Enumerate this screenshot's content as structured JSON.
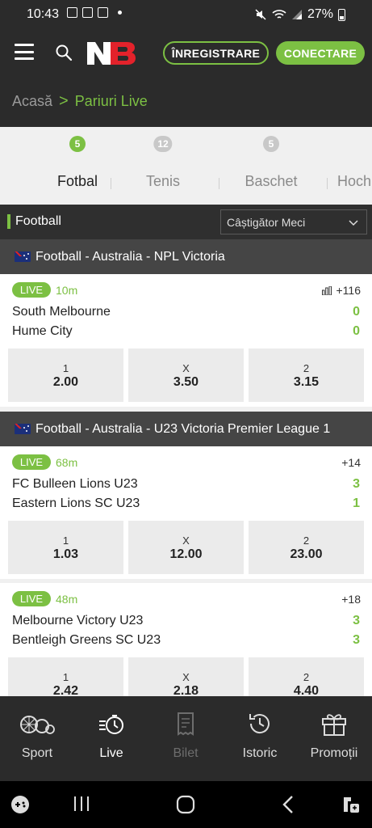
{
  "status_bar": {
    "time": "10:43",
    "battery": "27%"
  },
  "header": {
    "register_label": "ÎNREGISTRARE",
    "login_label": "CONECTARE"
  },
  "breadcrumb": {
    "home": "Acasă",
    "separator": ">",
    "current": "Pariuri Live"
  },
  "tabs": [
    {
      "label": "Fotbal",
      "count": "5",
      "active": true
    },
    {
      "label": "Tenis",
      "count": "12",
      "active": false
    },
    {
      "label": "Baschet",
      "count": "5",
      "active": false
    },
    {
      "label": "Hoch",
      "count": "",
      "active": false
    }
  ],
  "sport_bar": {
    "title": "Football",
    "market_select": "Câștigător Meci"
  },
  "leagues": [
    {
      "name": "Football - Australia - NPL Victoria",
      "matches": [
        {
          "status": "LIVE",
          "minute": "10m",
          "markets": "+116",
          "home": "South Melbourne",
          "away": "Hume City",
          "home_score": "0",
          "away_score": "0",
          "odds": [
            {
              "label": "1",
              "value": "2.00"
            },
            {
              "label": "X",
              "value": "3.50"
            },
            {
              "label": "2",
              "value": "3.15"
            }
          ]
        }
      ]
    },
    {
      "name": "Football - Australia - U23 Victoria Premier League 1",
      "matches": [
        {
          "status": "LIVE",
          "minute": "68m",
          "markets": "+14",
          "home": "FC Bulleen Lions U23",
          "away": "Eastern Lions SC U23",
          "home_score": "3",
          "away_score": "1",
          "odds": [
            {
              "label": "1",
              "value": "1.03"
            },
            {
              "label": "X",
              "value": "12.00"
            },
            {
              "label": "2",
              "value": "23.00"
            }
          ]
        },
        {
          "status": "LIVE",
          "minute": "48m",
          "markets": "+18",
          "home": "Melbourne Victory U23",
          "away": "Bentleigh Greens SC U23",
          "home_score": "3",
          "away_score": "3",
          "odds": [
            {
              "label": "1",
              "value": "2.42"
            },
            {
              "label": "X",
              "value": "2.18"
            },
            {
              "label": "2",
              "value": "4.40"
            }
          ]
        }
      ]
    }
  ],
  "bottom_nav": [
    {
      "label": "Sport",
      "icon": "sports-balls-icon",
      "state": "normal"
    },
    {
      "label": "Live",
      "icon": "live-stopwatch-icon",
      "state": "active"
    },
    {
      "label": "Bilet",
      "icon": "betslip-icon",
      "state": "disabled"
    },
    {
      "label": "Istoric",
      "icon": "history-icon",
      "state": "normal"
    },
    {
      "label": "Promoții",
      "icon": "gift-icon",
      "state": "normal"
    }
  ],
  "colors": {
    "accent": "#7cc043",
    "header_bg": "#2b2b2b",
    "league_bg": "#454545",
    "logo_red": "#e3222b"
  }
}
